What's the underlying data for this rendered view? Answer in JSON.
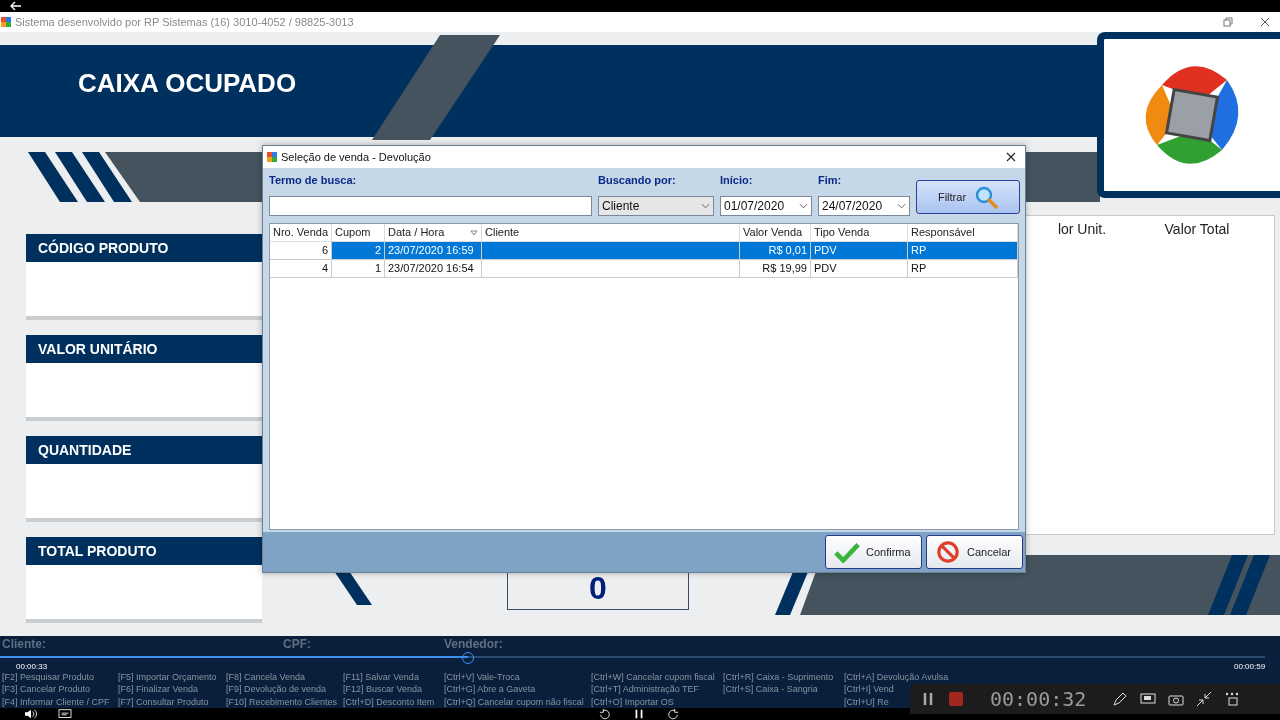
{
  "window": {
    "title": "Sistema desenvolvido por RP Sistemas (16) 3010-4052 / 98825-3013"
  },
  "header": {
    "title": "CAIXA OCUPADO"
  },
  "fields": [
    {
      "label": "CÓDIGO PRODUTO"
    },
    {
      "label": "VALOR UNITÁRIO"
    },
    {
      "label": "QUANTIDADE"
    },
    {
      "label": "TOTAL PRODUTO"
    }
  ],
  "items_table": {
    "columns": [
      "lor Unit.",
      "Valor Total"
    ]
  },
  "total": "0",
  "customer_bar": {
    "labels": [
      "Cliente:",
      "CPF:",
      "Vendedor:"
    ]
  },
  "shortcuts": [
    [
      "[F2] Pesquisar Produto",
      "[F3] Cancelar Produto",
      "[F4] Informar Cliente / CPF"
    ],
    [
      "[F5] Importar Orçamento",
      "[F6] Finalizar Venda",
      "[F7] Consultar Produto"
    ],
    [
      "[F8] Cancela Venda",
      "[F9] Devolução de venda",
      "[F10] Recebimento Clientes"
    ],
    [
      "[F11] Salvar Venda",
      "[F12] Buscar Venda",
      "[Ctrl+D] Desconto Item"
    ],
    [
      "[Ctrl+V] Vale-Troca",
      "[Ctrl+G] Abre a Gaveta",
      "[Ctrl+Q] Cancelar cupom não fiscal"
    ],
    [
      "[Ctrl+W] Cancelar cupom fiscal",
      "[Ctrl+T] Administração TEF",
      "[Ctrl+O] Importar OS"
    ],
    [
      "[Ctrl+R] Caixa - Suprimento",
      "[Ctrl+S] Caixa - Sangria"
    ],
    [
      "[Ctrl+A] Devolução Avulsa",
      "[Ctrl+I] Vend",
      "[Ctrl+U] Re"
    ]
  ],
  "dialog": {
    "title": "Seleção de venda - Devolução",
    "search_label": "Termo de busca:",
    "search_by_label": "Buscando por:",
    "search_by": "Cliente",
    "start_label": "Início:",
    "start": "01/07/2020",
    "end_label": "Fim:",
    "end": "24/07/2020",
    "filter_button": "Filtrar",
    "columns": [
      "Nro. Venda",
      "Cupom",
      "Data / Hora",
      "Cliente",
      "Valor Venda",
      "Tipo Venda",
      "Responsável"
    ],
    "rows": [
      {
        "cells": [
          "6",
          "2",
          "23/07/2020 16:59",
          "",
          "R$ 0,01",
          "PDV",
          "RP"
        ],
        "selected": true
      },
      {
        "cells": [
          "4",
          "1",
          "23/07/2020 16:54",
          "",
          "R$ 19,99",
          "PDV",
          "RP"
        ],
        "selected": false
      }
    ],
    "buttons": [
      {
        "label": "Confirma",
        "kind": "confirm"
      },
      {
        "label": "Cancelar",
        "kind": "cancel"
      }
    ]
  },
  "player": {
    "elapsed": "00:00:33",
    "duration": "00:00:59",
    "level": 0.37
  },
  "recorder": {
    "time": "00:00:32"
  }
}
